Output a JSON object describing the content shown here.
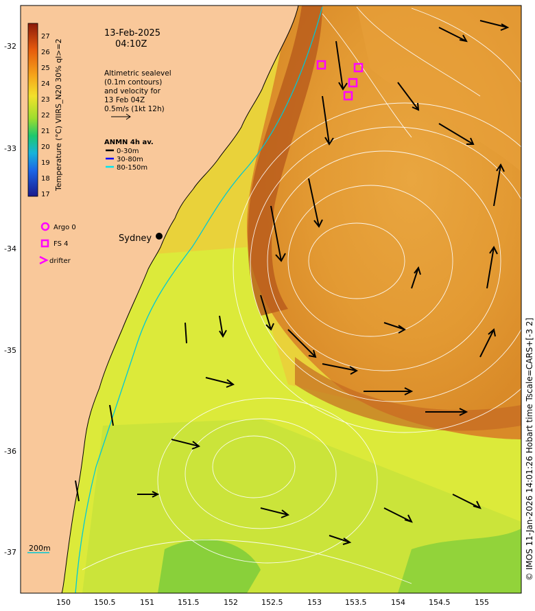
{
  "header": {
    "date": "13-Feb-2025",
    "time": "04:10Z"
  },
  "altimetry_note": {
    "lines": [
      "Altimetric sealevel",
      "(0.1m contours)",
      "and velocity for",
      "13 Feb 04Z",
      "0.5m/s (1kt 12h)"
    ]
  },
  "anmn_legend": {
    "title": "ANMN 4h av.",
    "items": [
      {
        "label": "0-30m",
        "color": "#000000"
      },
      {
        "label": "30-80m",
        "color": "#0000ff"
      },
      {
        "label": "80-150m",
        "color": "#00e5ee"
      }
    ]
  },
  "symbol_legend": {
    "argo": "Argo 0",
    "fs": "FS 4",
    "drifter": "drifter",
    "marker_color": "#ff00ff"
  },
  "place_labels": {
    "sydney": "Sydney",
    "depth": "200m"
  },
  "colorbar": {
    "label": "Temperature (°C) VIIRS_N20 30% ql>=2",
    "ticks": [
      "27",
      "26",
      "25",
      "24",
      "23",
      "22",
      "21",
      "20",
      "19",
      "18",
      "17"
    ]
  },
  "credit": "© IMOS 11-Jan-2026 14:01:26 Hobart time Tscale=CARS+[-3 2]",
  "axes": {
    "x_ticks": [
      "150",
      "150.5",
      "151",
      "151.5",
      "152",
      "152.5",
      "153",
      "153.5",
      "154",
      "154.5",
      "155"
    ],
    "y_ticks": [
      "-32",
      "-33",
      "-34",
      "-35",
      "-36",
      "-37"
    ]
  },
  "colors": {
    "land": "#f9c89a",
    "sea_warm": "#e8a23a",
    "sea_mid": "#eee13a",
    "sea_cool": "#b8e23a",
    "frame": "#000000"
  },
  "stations": {
    "fs_squares": [
      {
        "lon": 153.05,
        "lat": -32.25
      },
      {
        "lon": 153.5,
        "lat": -32.3
      },
      {
        "lon": 153.45,
        "lat": -32.48
      },
      {
        "lon": 153.38,
        "lat": -32.65
      }
    ],
    "sydney_point": {
      "lon": 151.21,
      "lat": -33.87
    }
  }
}
